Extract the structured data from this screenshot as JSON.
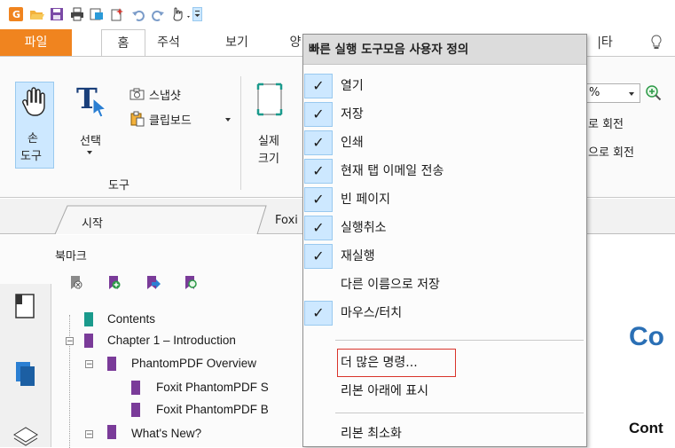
{
  "tabs": {
    "file": "파일",
    "home": "홈",
    "comment": "주석",
    "view": "보기",
    "cut_char": "양",
    "right_tab": "|타"
  },
  "ribbon": {
    "hand_tool_line1": "손",
    "hand_tool_line2": "도구",
    "select_label": "선택",
    "snapshot_label": "스냅샷",
    "clipboard_label": "클립보드",
    "tools_group_label": "도구",
    "actual_size_line1": "실제",
    "actual_size_line2": "크기",
    "zoom_value": "%",
    "rotate_right": "로 회전",
    "rotate_left": "으로 회전"
  },
  "doc_tabs": {
    "start": "시작",
    "foxit": "Foxi"
  },
  "bookmarks": {
    "pane_title": "북마크",
    "items": [
      {
        "label": "Contents"
      },
      {
        "label": "Chapter 1 – Introduction"
      },
      {
        "label": "PhantomPDF Overview"
      },
      {
        "label": "Foxit PhantomPDF S"
      },
      {
        "label": "Foxit PhantomPDF B"
      },
      {
        "label": "What's New?"
      }
    ]
  },
  "document": {
    "heading": "Co",
    "subheading": "Cont"
  },
  "menu": {
    "title": "빠른 실행 도구모음 사용자 정의",
    "items": [
      {
        "label": "열기",
        "checked": true
      },
      {
        "label": "저장",
        "checked": true
      },
      {
        "label": "인쇄",
        "checked": true
      },
      {
        "label": "현재 탭 이메일 전송",
        "checked": true
      },
      {
        "label": "빈 페이지",
        "checked": true
      },
      {
        "label": "실행취소",
        "checked": true
      },
      {
        "label": "재실행",
        "checked": true
      },
      {
        "label": "다른 이름으로 저장",
        "checked": false
      },
      {
        "label": "마우스/터치",
        "checked": true
      }
    ],
    "more_commands": "더 많은 명령...",
    "show_below_ribbon": "리본 아래에 표시",
    "minimize_ribbon": "리본 최소화",
    "check_glyph": "✓"
  },
  "colors": {
    "accent_orange": "#f0841f",
    "bookmark_teal": "#1a9a8c",
    "bookmark_purple": "#7a3b99",
    "doc_heading_blue": "#2a6fb5",
    "menu_check_bg": "#cde8ff",
    "more_highlight_red": "#d9342b"
  }
}
